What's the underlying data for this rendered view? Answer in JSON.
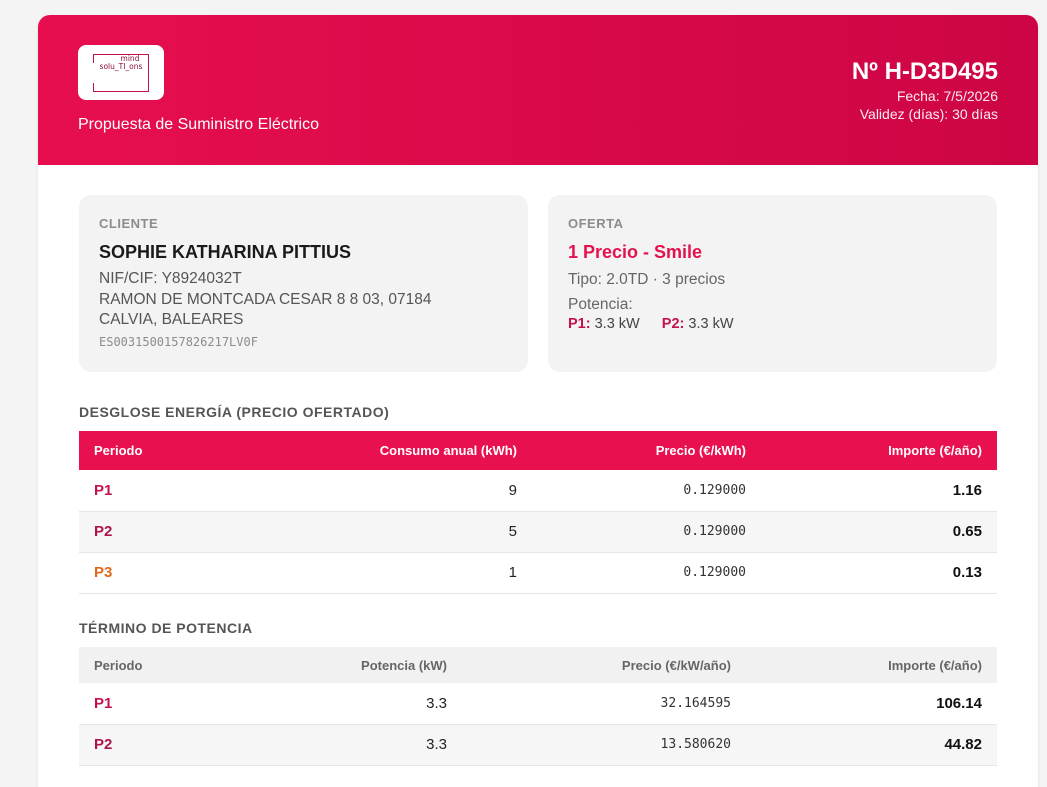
{
  "header": {
    "logo_line1": "mind",
    "logo_line2": "solu_TI_ons",
    "subtitle": "Propuesta de Suministro Eléctrico",
    "doc_number": "Nº H-D3D495",
    "date": "Fecha: 7/5/2026",
    "validity": "Validez (días): 30 días"
  },
  "client": {
    "label": "CLIENTE",
    "name": "SOPHIE KATHARINA PITTIUS",
    "nif": "NIF/CIF: Y8924032T",
    "address1": "RAMON DE MONTCADA CESAR 8 8 03, 07184",
    "address2": "CALVIA, BALEARES",
    "cups": "ES0031500157826217LV0F"
  },
  "offer": {
    "label": "OFERTA",
    "name": "1 Precio - Smile",
    "type": "Tipo: 2.0TD · 3 precios",
    "power_label": "Potencia:",
    "powers": [
      {
        "label": "P1:",
        "value": "3.3 kW"
      },
      {
        "label": "P2:",
        "value": "3.3 kW"
      }
    ]
  },
  "energy": {
    "title": "DESGLOSE ENERGÍA (PRECIO OFERTADO)",
    "headers": [
      "Periodo",
      "Consumo anual (kWh)",
      "Precio (€/kWh)",
      "Importe (€/año)"
    ],
    "rows": [
      {
        "period": "P1",
        "consumption": "9",
        "price": "0.129000",
        "amount": "1.16"
      },
      {
        "period": "P2",
        "consumption": "5",
        "price": "0.129000",
        "amount": "0.65"
      },
      {
        "period": "P3",
        "consumption": "1",
        "price": "0.129000",
        "amount": "0.13"
      }
    ]
  },
  "power": {
    "title": "TÉRMINO DE POTENCIA",
    "headers": [
      "Periodo",
      "Potencia (kW)",
      "Precio (€/kW/año)",
      "Importe (€/año)"
    ],
    "rows": [
      {
        "period": "P1",
        "power": "3.3",
        "price": "32.164595",
        "amount": "106.14"
      },
      {
        "period": "P2",
        "power": "3.3",
        "price": "13.580620",
        "amount": "44.82"
      }
    ]
  },
  "colors": {
    "brand": "#e8104f",
    "p1": "#c4124e",
    "p2": "#b0124e",
    "p3": "#e06a1b"
  }
}
